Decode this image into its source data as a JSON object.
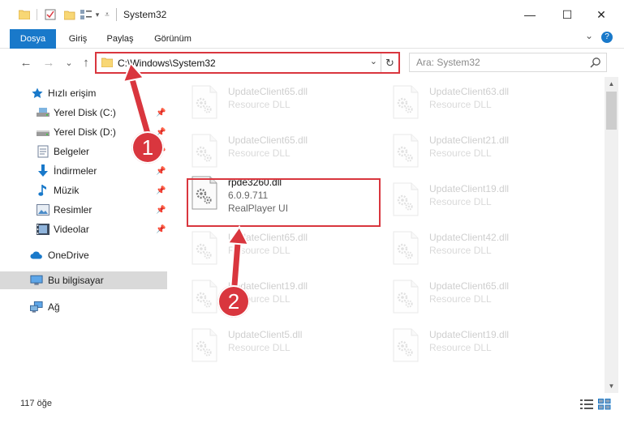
{
  "window": {
    "title": "System32",
    "min_glyph": "—",
    "max_glyph": "☐",
    "close_glyph": "✕"
  },
  "ribbon": {
    "tabs": [
      "Dosya",
      "Giriş",
      "Paylaş",
      "Görünüm"
    ],
    "collapse_glyph": "⌄",
    "help_glyph": "?"
  },
  "navbar": {
    "back_glyph": "←",
    "forward_glyph": "→",
    "recent_glyph": "⌄",
    "up_glyph": "↑",
    "address": "C:\\Windows\\System32",
    "address_dropdown_glyph": "⌄",
    "refresh_glyph": "↻",
    "search_placeholder": "Ara: System32"
  },
  "sidebar": {
    "items": [
      {
        "label": "Hızlı erişim",
        "icon": "star-icon",
        "pinned": false
      },
      {
        "label": "Yerel Disk (C:)",
        "icon": "drive-icon",
        "pinned": true
      },
      {
        "label": "Yerel Disk (D:)",
        "icon": "drive-icon",
        "pinned": true
      },
      {
        "label": "Belgeler",
        "icon": "documents-icon",
        "pinned": true
      },
      {
        "label": "İndirmeler",
        "icon": "download-icon",
        "pinned": true
      },
      {
        "label": "Müzik",
        "icon": "music-icon",
        "pinned": true
      },
      {
        "label": "Resimler",
        "icon": "pictures-icon",
        "pinned": true
      },
      {
        "label": "Videolar",
        "icon": "videos-icon",
        "pinned": true
      },
      {
        "label": "OneDrive",
        "icon": "cloud-icon",
        "pinned": false
      },
      {
        "label": "Bu bilgisayar",
        "icon": "computer-icon",
        "pinned": false
      },
      {
        "label": "Ağ",
        "icon": "network-icon",
        "pinned": false
      }
    ],
    "pin_glyph": "📌"
  },
  "files": [
    {
      "name": "UpdateClient65.dll",
      "desc": "Resource DLL"
    },
    {
      "name": "UpdateClient63.dll",
      "desc": "Resource DLL"
    },
    {
      "name": "UpdateClient65.dll",
      "desc": "Resource DLL"
    },
    {
      "name": "UpdateClient21.dll",
      "desc": "Resource DLL"
    },
    {
      "name": "rpde3260.dll",
      "desc": "6.0.9.711",
      "extra": "RealPlayer UI"
    },
    {
      "name": "UpdateClient19.dll",
      "desc": "Resource DLL"
    },
    {
      "name": "UpdateClient65.dll",
      "desc": "Resource DLL"
    },
    {
      "name": "UpdateClient42.dll",
      "desc": "Resource DLL"
    },
    {
      "name": "UpdateClient19.dll",
      "desc": "Resource DLL"
    },
    {
      "name": "UpdateClient65.dll",
      "desc": "Resource DLL"
    },
    {
      "name": "UpdateClient5.dll",
      "desc": "Resource DLL"
    },
    {
      "name": "UpdateClient19.dll",
      "desc": "Resource DLL"
    }
  ],
  "status": {
    "item_count": "117 öğe"
  },
  "callouts": {
    "one": "1",
    "two": "2"
  },
  "colors": {
    "accent": "#1979ca",
    "highlight": "#d9363e",
    "folder": "#f8d775"
  }
}
